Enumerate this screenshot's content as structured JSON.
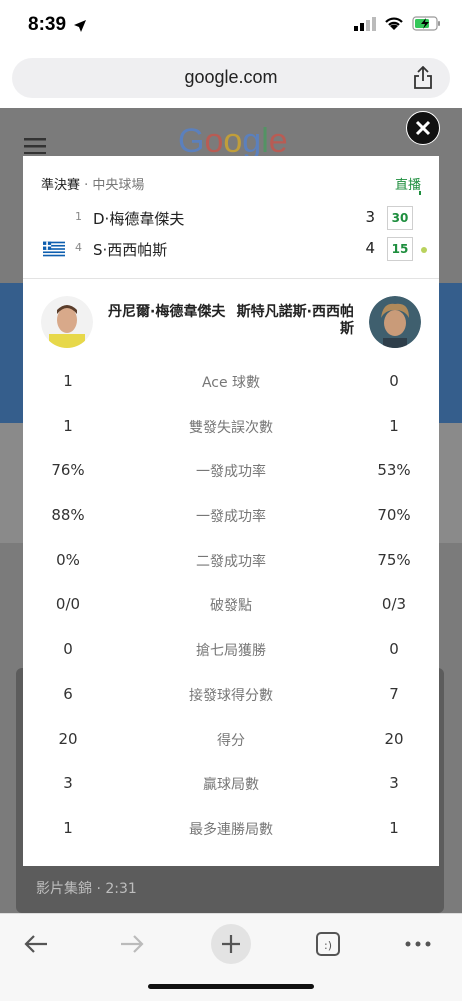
{
  "status_bar": {
    "time": "8:39"
  },
  "address_bar": {
    "url": "google.com"
  },
  "background": {
    "logo": "Google",
    "video_caption": "影片集錦 · 2:31"
  },
  "card": {
    "round_label": "準決賽",
    "separator": " · ",
    "court_label": "中央球場",
    "live_label": "直播",
    "players": [
      {
        "seed": "1",
        "name": "D·梅德韋傑夫",
        "sets": "3",
        "game": "30",
        "flag": "",
        "serving": false
      },
      {
        "seed": "4",
        "name": "S·西西帕斯",
        "sets": "4",
        "game": "15",
        "flag": "greece-flag",
        "serving": true
      }
    ],
    "player_left_full": "丹尼爾·梅德韋傑夫",
    "player_right_full": "斯特凡諾斯·西西帕斯",
    "stats": [
      {
        "left": "1",
        "label": "Ace 球數",
        "right": "0"
      },
      {
        "left": "1",
        "label": "雙發失誤次數",
        "right": "1"
      },
      {
        "left": "76%",
        "label": "一發成功率",
        "right": "53%"
      },
      {
        "left": "88%",
        "label": "一發成功率",
        "right": "70%"
      },
      {
        "left": "0%",
        "label": "二發成功率",
        "right": "75%"
      },
      {
        "left": "0/0",
        "label": "破發點",
        "right": "0/3"
      },
      {
        "left": "0",
        "label": "搶七局獲勝",
        "right": "0"
      },
      {
        "left": "6",
        "label": "接發球得分數",
        "right": "7"
      },
      {
        "left": "20",
        "label": "得分",
        "right": "20"
      },
      {
        "left": "3",
        "label": "贏球局數",
        "right": "3"
      },
      {
        "left": "1",
        "label": "最多連勝局數",
        "right": "1"
      }
    ]
  },
  "colors": {
    "accent_green": "#1e8e3e",
    "serve_dot": "#b9d25d"
  },
  "toolbar": {
    "back_icon": "back-arrow-icon",
    "forward_icon": "forward-arrow-icon",
    "new_tab_icon": "plus-icon",
    "tabs_icon": "tab-switcher-icon",
    "more_icon": "more-icon"
  }
}
